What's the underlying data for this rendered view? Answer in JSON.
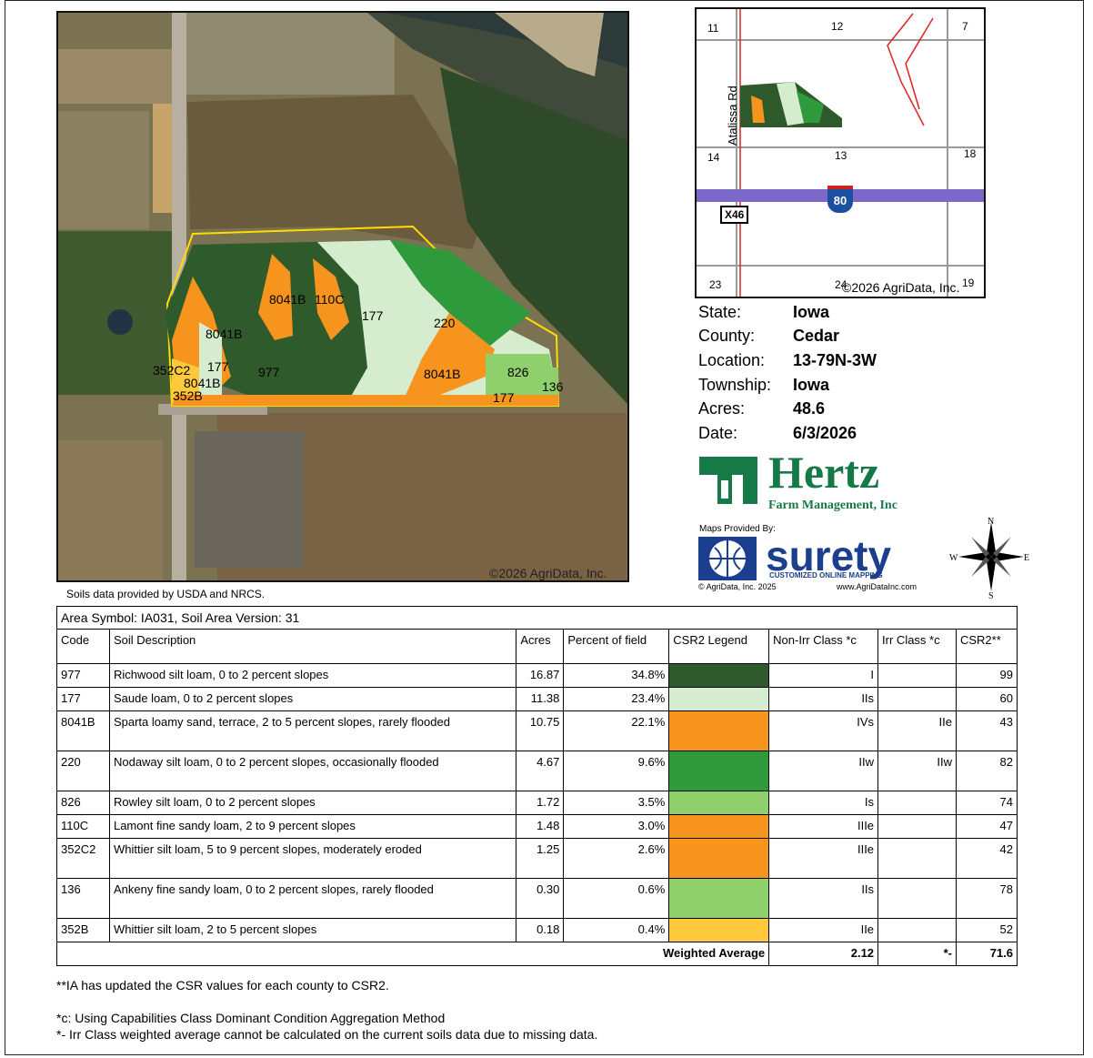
{
  "map": {
    "copyright": "©2026 AgriData, Inc.",
    "labels": [
      "8041B",
      "110C",
      "177",
      "220",
      "8041B",
      "977",
      "8041B",
      "177",
      "352C2",
      "8041B",
      "352B",
      "826",
      "136",
      "177"
    ]
  },
  "location_map": {
    "sections": [
      "11",
      "12",
      "7",
      "14",
      "13",
      "18",
      "23",
      "24",
      "19"
    ],
    "road_name": "Atalissa Rd",
    "route": "X46",
    "interstate": "80",
    "copyright": "©2026 AgriData, Inc."
  },
  "info": [
    {
      "key": "State:",
      "value": "Iowa"
    },
    {
      "key": "County:",
      "value": "Cedar"
    },
    {
      "key": "Location:",
      "value": "13-79N-3W"
    },
    {
      "key": "Township:",
      "value": "Iowa"
    },
    {
      "key": "Acres:",
      "value": "48.6"
    },
    {
      "key": "Date:",
      "value": "6/3/2026"
    }
  ],
  "brand": {
    "hertz_name": "Hertz",
    "hertz_sub": "Farm Management, Inc",
    "maps_provided": "Maps Provided By:",
    "surety_name": "surety",
    "surety_tag": "CUSTOMIZED ONLINE MAPPING",
    "surety_copy": "© AgriData, Inc. 2025",
    "surety_url": "www.AgriDataInc.com",
    "compass": {
      "n": "N",
      "s": "S",
      "e": "E",
      "w": "W"
    }
  },
  "soils_source": "Soils data provided by USDA and NRCS.",
  "table": {
    "area_symbol": "Area Symbol: IA031, Soil Area Version: 31",
    "headers": [
      "Code",
      "Soil Description",
      "Acres",
      "Percent of field",
      "CSR2 Legend",
      "Non-Irr Class *c",
      "Irr Class *c",
      "CSR2**"
    ],
    "rows": [
      {
        "code": "977",
        "desc": "Richwood silt loam, 0 to 2 percent slopes",
        "acres": "16.87",
        "pct": "34.8%",
        "color": "#2f5a2c",
        "nonirr": "I",
        "irr": "",
        "csr2": "99"
      },
      {
        "code": "177",
        "desc": "Saude loam, 0 to 2 percent slopes",
        "acres": "11.38",
        "pct": "23.4%",
        "color": "#d6eccf",
        "nonirr": "IIs",
        "irr": "",
        "csr2": "60"
      },
      {
        "code": "8041B",
        "desc": "Sparta loamy sand, terrace, 2 to 5 percent slopes, rarely flooded",
        "acres": "10.75",
        "pct": "22.1%",
        "color": "#f7941d",
        "nonirr": "IVs",
        "irr": "IIe",
        "csr2": "43"
      },
      {
        "code": "220",
        "desc": "Nodaway silt loam, 0 to 2 percent slopes, occasionally flooded",
        "acres": "4.67",
        "pct": "9.6%",
        "color": "#2e9a3c",
        "nonirr": "IIw",
        "irr": "IIw",
        "csr2": "82"
      },
      {
        "code": "826",
        "desc": "Rowley silt loam, 0 to 2 percent slopes",
        "acres": "1.72",
        "pct": "3.5%",
        "color": "#8fd06c",
        "nonirr": "Is",
        "irr": "",
        "csr2": "74"
      },
      {
        "code": "110C",
        "desc": "Lamont fine sandy loam, 2 to 9 percent slopes",
        "acres": "1.48",
        "pct": "3.0%",
        "color": "#f7941d",
        "nonirr": "IIIe",
        "irr": "",
        "csr2": "47"
      },
      {
        "code": "352C2",
        "desc": "Whittier silt loam, 5 to 9 percent slopes, moderately eroded",
        "acres": "1.25",
        "pct": "2.6%",
        "color": "#f7941d",
        "nonirr": "IIIe",
        "irr": "",
        "csr2": "42"
      },
      {
        "code": "136",
        "desc": "Ankeny fine sandy loam, 0 to 2 percent slopes, rarely flooded",
        "acres": "0.30",
        "pct": "0.6%",
        "color": "#8fd06c",
        "nonirr": "IIs",
        "irr": "",
        "csr2": "78"
      },
      {
        "code": "352B",
        "desc": "Whittier silt loam, 2 to 5 percent slopes",
        "acres": "0.18",
        "pct": "0.4%",
        "color": "#ffc83d",
        "nonirr": "IIe",
        "irr": "",
        "csr2": "52"
      }
    ],
    "weighted": {
      "label": "Weighted Average",
      "nonirr": "2.12",
      "irr": "*-",
      "csr2": "71.6"
    }
  },
  "notes": [
    "**IA has updated the CSR values for each county to CSR2.",
    "",
    "*c: Using Capabilities Class Dominant Condition Aggregation Method",
    "*- Irr Class weighted average cannot be calculated on the current soils data due to missing data."
  ]
}
